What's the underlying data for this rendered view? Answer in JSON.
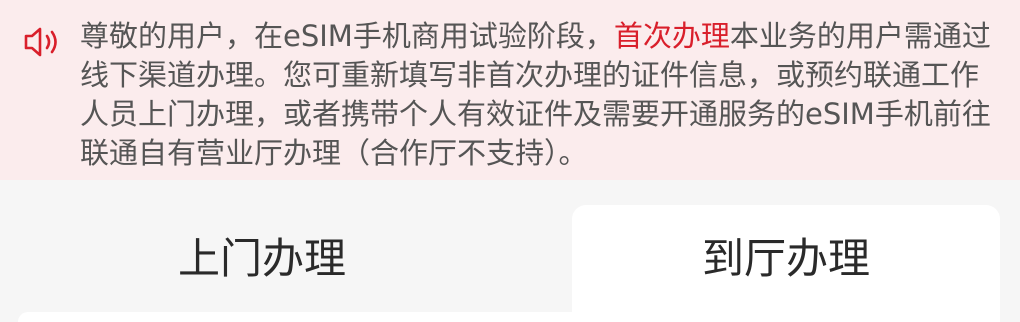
{
  "notice": {
    "icon": "speaker-icon",
    "text_part1": "尊敬的用户，在eSIM手机商用试验阶段，",
    "text_highlight": "首次办理",
    "text_part2": "本业务的用户需通过线下渠道办理。您可重新填写非首次办理的证件信息，或预约联通工作人员上门办理，或者携带个人有效证件及需要开通服务的eSIM手机前往联通自有营业厅办理（合作厅不支持）。",
    "highlight_color": "#d91f2b"
  },
  "tabs": [
    {
      "label": "上门办理"
    },
    {
      "label": "到厅办理"
    }
  ]
}
